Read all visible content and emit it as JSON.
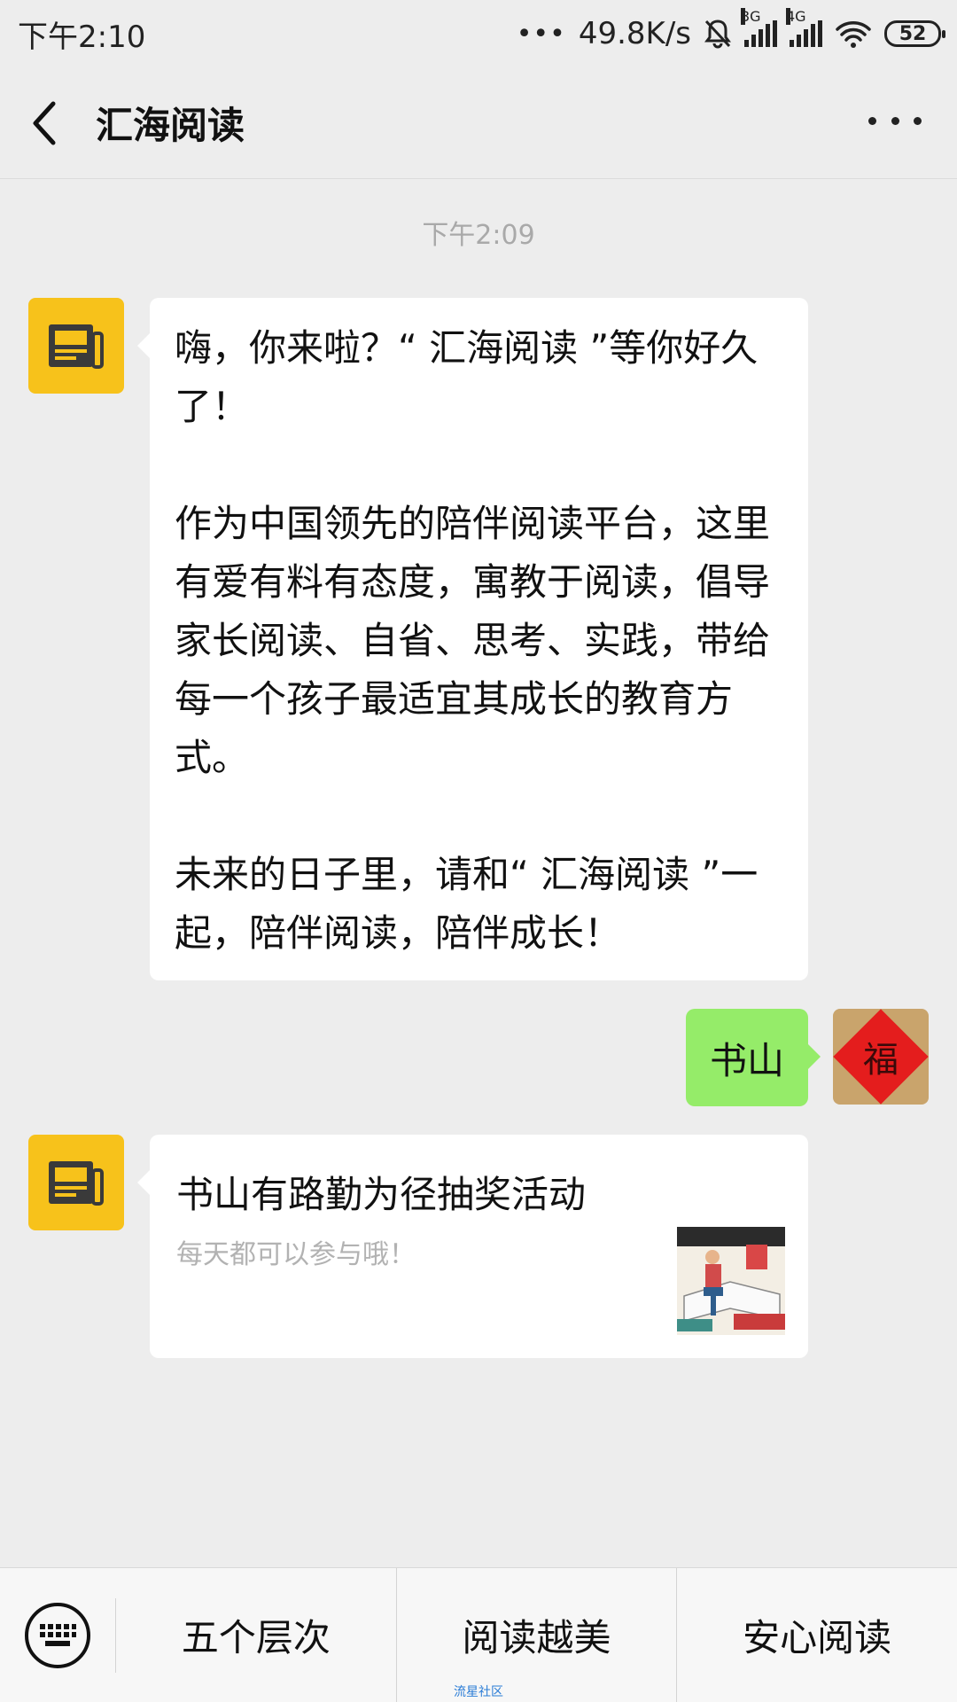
{
  "status_bar": {
    "time": "下午2:10",
    "dots": "•••",
    "net_speed": "49.8K/s",
    "sig1_tag": "3G",
    "sig2_tag": "4G",
    "battery": "52"
  },
  "header": {
    "title": "汇海阅读"
  },
  "chat": {
    "timestamp": "下午2:09",
    "welcome_message": "嗨，你来啦？“ 汇海阅读 ”等你好久了！\n\n作为中国领先的陪伴阅读平台，这里有爱有料有态度，寓教于阅读，倡导家长阅读、自省、思考、实践，带给每一个孩子最适宜其成长的教育方式。\n\n未来的日子里，请和“ 汇海阅读 ”一起，陪伴阅读，陪伴成长！",
    "user_message": "书山",
    "user_avatar_char": "福",
    "article": {
      "title": "书山有路勤为径抽奖活动",
      "desc": "每天都可以参与哦！"
    }
  },
  "menu": {
    "items": [
      "五个层次",
      "阅读越美",
      "安心阅读"
    ]
  },
  "footer": {
    "watermark": "流星社区"
  },
  "colors": {
    "official_avatar": "#f7c21b",
    "user_bubble": "#95ec69",
    "page_bg": "#ededed"
  }
}
